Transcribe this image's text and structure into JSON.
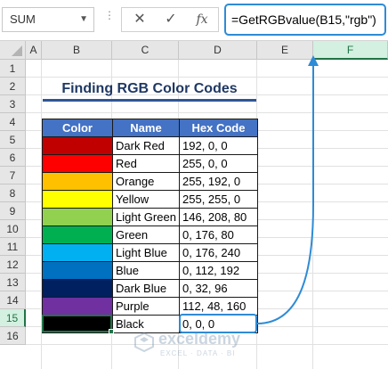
{
  "formula_bar": {
    "name_box": "SUM",
    "cancel_glyph": "✕",
    "enter_glyph": "✓",
    "fx_label": "fx",
    "formula": "=GetRGBvalue(B15,\"rgb\")"
  },
  "columns": [
    "A",
    "B",
    "C",
    "D",
    "E",
    "F"
  ],
  "rows": [
    "1",
    "2",
    "3",
    "4",
    "5",
    "6",
    "7",
    "8",
    "9",
    "10",
    "11",
    "12",
    "13",
    "14",
    "15",
    "16"
  ],
  "selected_column": "F",
  "selected_row": "15",
  "title": "Finding RGB Color Codes",
  "table": {
    "headers": [
      "Color",
      "Name",
      "Hex Code"
    ],
    "rows": [
      {
        "swatch": "#c00000",
        "name": "Dark Red",
        "code": "192, 0, 0"
      },
      {
        "swatch": "#ff0000",
        "name": "Red",
        "code": "255, 0, 0"
      },
      {
        "swatch": "#ffc000",
        "name": "Orange",
        "code": "255, 192, 0"
      },
      {
        "swatch": "#ffff00",
        "name": "Yellow",
        "code": "255, 255, 0"
      },
      {
        "swatch": "#92d050",
        "name": "Light Green",
        "code": "146, 208, 80"
      },
      {
        "swatch": "#00b050",
        "name": "Green",
        "code": "0, 176, 80"
      },
      {
        "swatch": "#00b0f0",
        "name": "Light Blue",
        "code": "0, 176, 240"
      },
      {
        "swatch": "#0070c0",
        "name": "Blue",
        "code": "0, 112, 192"
      },
      {
        "swatch": "#002060",
        "name": "Dark Blue",
        "code": "0, 32, 96"
      },
      {
        "swatch": "#7030a0",
        "name": "Purple",
        "code": "112, 48, 160"
      },
      {
        "swatch": "#000000",
        "name": "Black",
        "code": "0, 0, 0"
      }
    ]
  },
  "colors": {
    "header_bg": "#4472c4",
    "accent_blue": "#2e8bd6",
    "selection_green": "#217346",
    "title_color": "#1f3864"
  },
  "watermark": {
    "name": "exceldemy",
    "tagline": "EXCEL · DATA · BI"
  }
}
